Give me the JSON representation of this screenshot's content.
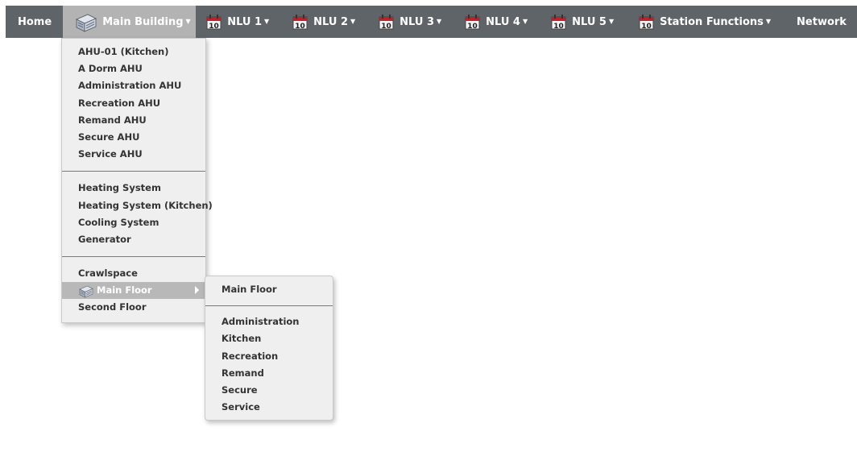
{
  "nav": {
    "home": "Home",
    "main_building": "Main Building",
    "nlu1": "NLU 1",
    "nlu2": "NLU 2",
    "nlu3": "NLU 3",
    "nlu4": "NLU 4",
    "nlu5": "NLU 5",
    "station_functions": "Station Functions",
    "network": "Network",
    "calendar_day": "10"
  },
  "main_menu": {
    "ahu": [
      "AHU-01 (Kitchen)",
      "A Dorm AHU",
      "Administration AHU",
      "Recreation AHU",
      "Remand AHU",
      "Secure AHU",
      "Service AHU"
    ],
    "systems": [
      "Heating System",
      "Heating System (Kitchen)",
      "Cooling System",
      "Generator"
    ],
    "floors": [
      "Crawlspace",
      "Main Floor",
      "Second Floor"
    ]
  },
  "submenu": {
    "header": "Main Floor",
    "items": [
      "Administration",
      "Kitchen",
      "Recreation",
      "Remand",
      "Secure",
      "Service"
    ]
  },
  "colors": {
    "navbar": "#5f6469",
    "active_tab": "#b3b3b3",
    "menu_bg": "#efefef",
    "highlight": "#b8b8b8"
  }
}
